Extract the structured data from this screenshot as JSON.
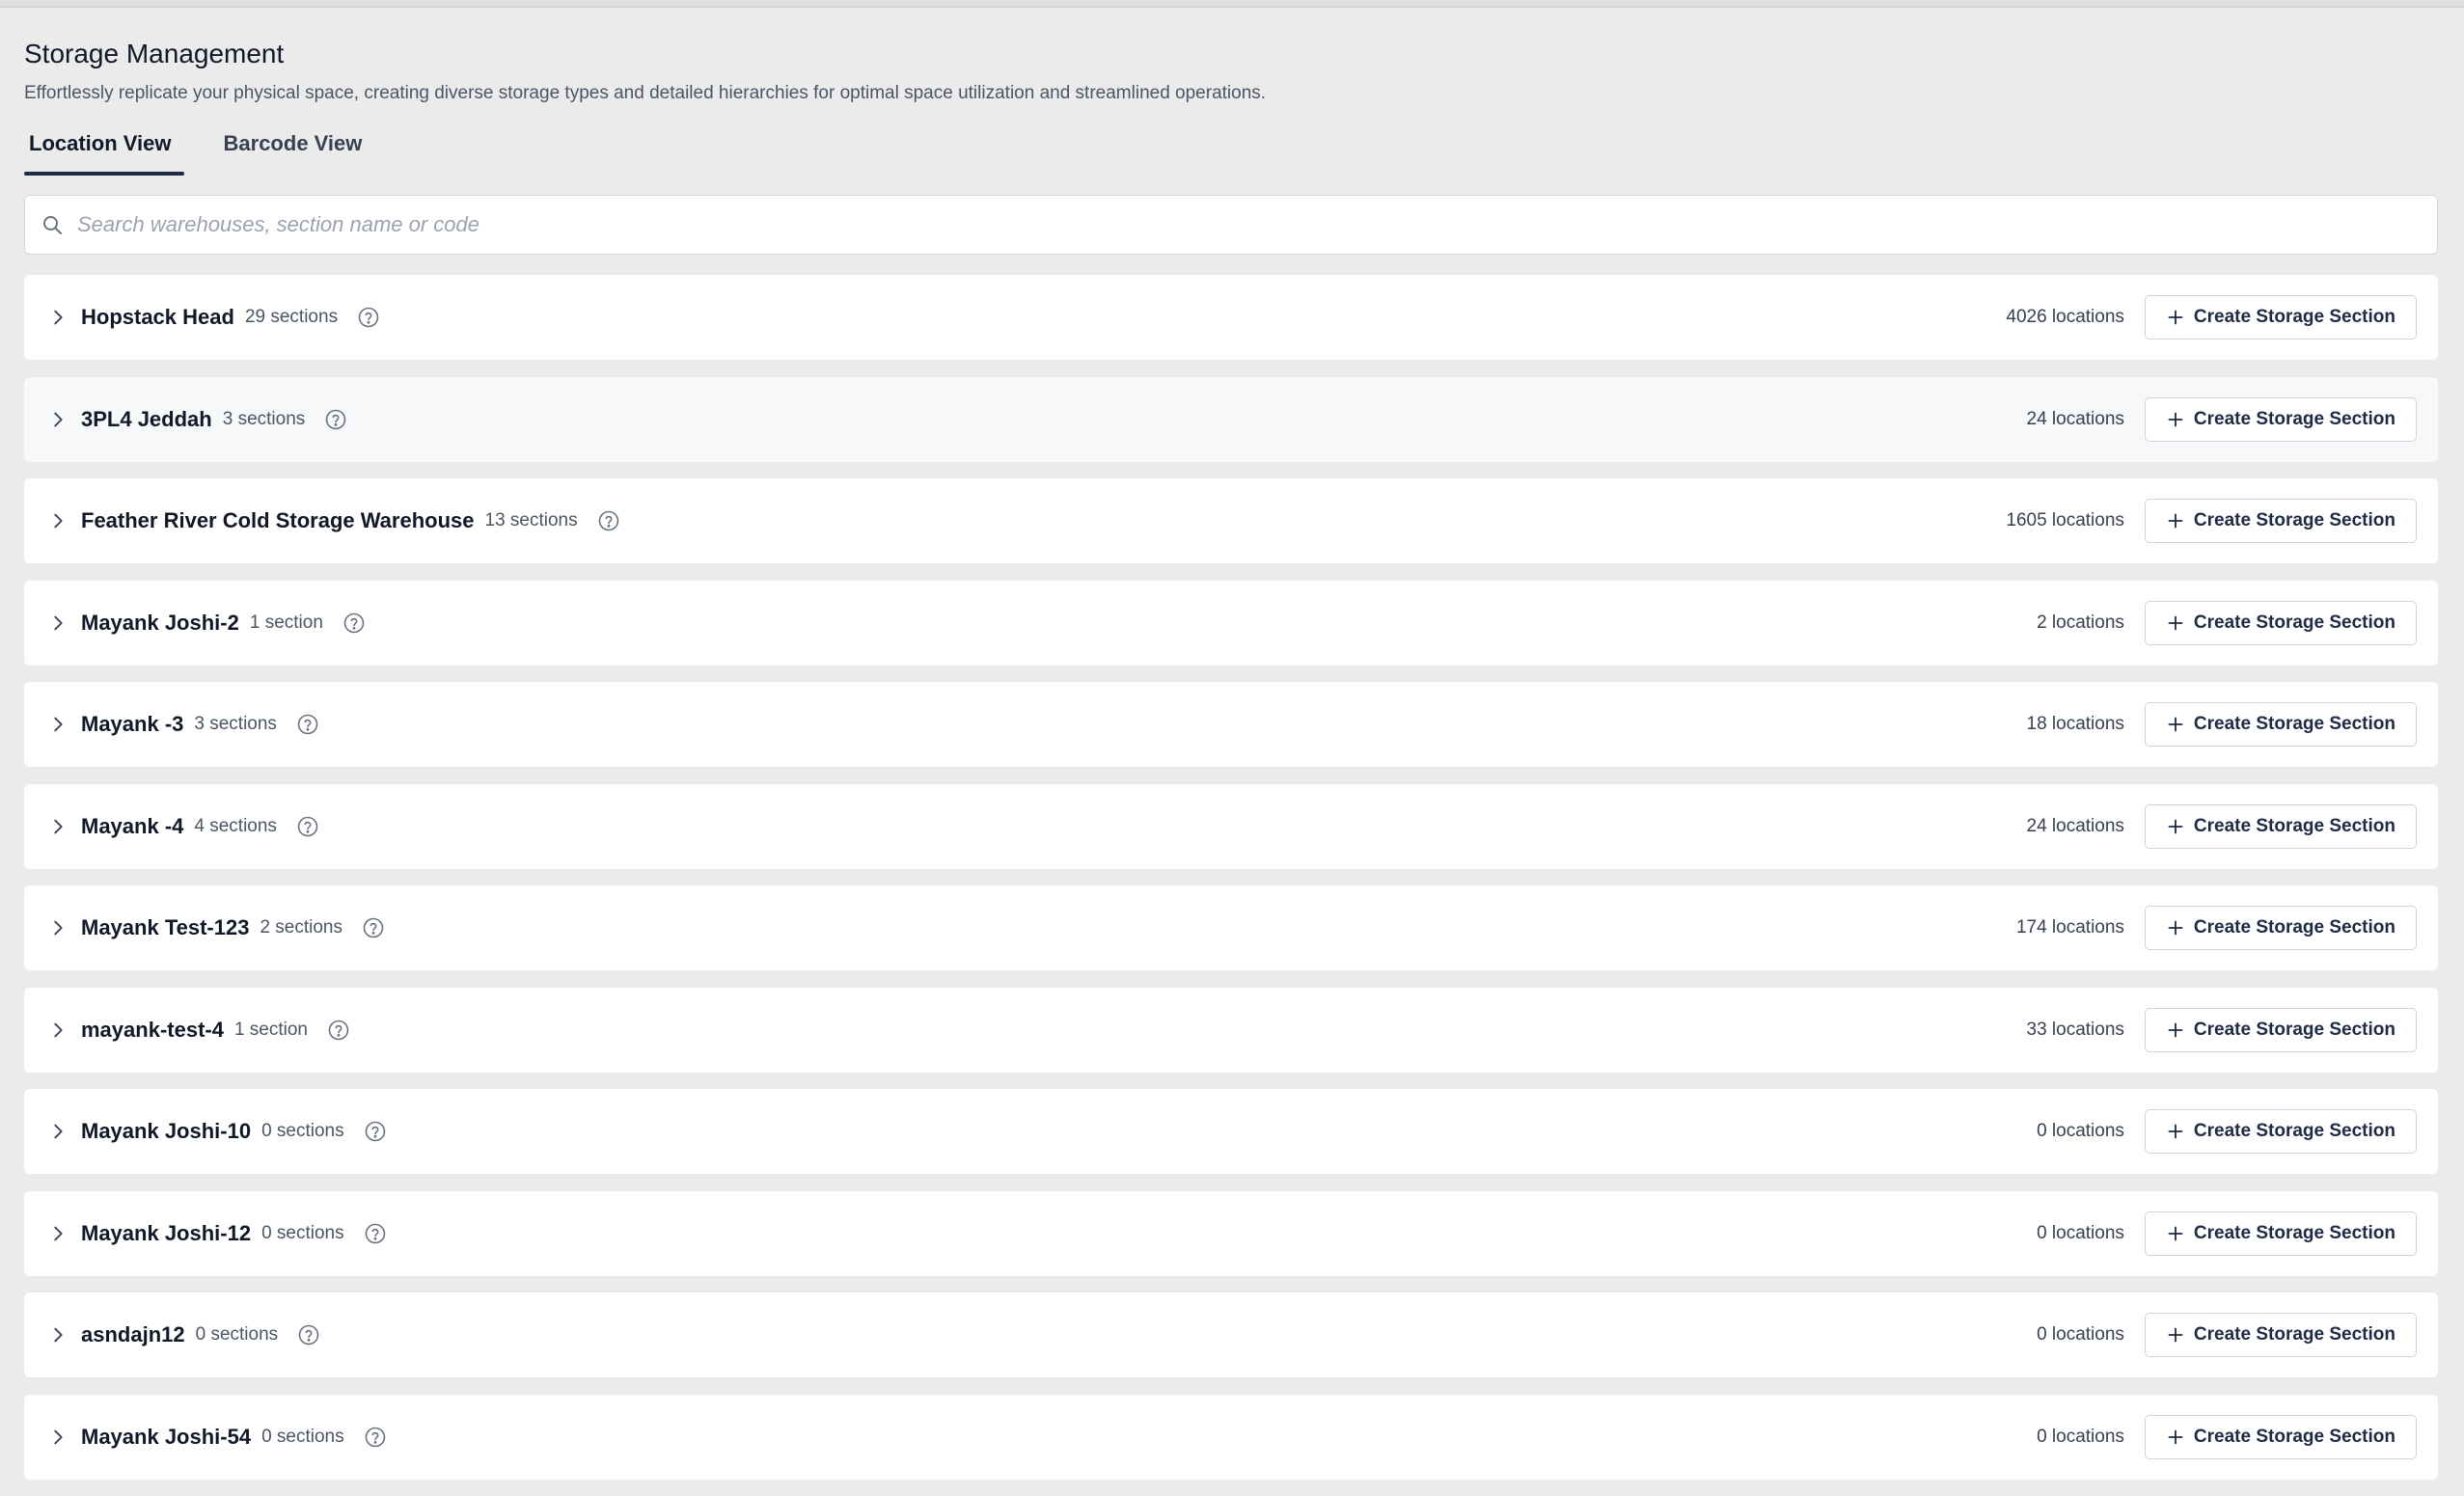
{
  "page": {
    "title": "Storage Management",
    "description": "Effortlessly replicate your physical space, creating diverse storage types and detailed hierarchies for optimal space utilization and streamlined operations."
  },
  "tabs": [
    {
      "label": "Location View",
      "active": true
    },
    {
      "label": "Barcode View",
      "active": false
    }
  ],
  "search": {
    "placeholder": "Search warehouses, section name or code",
    "value": ""
  },
  "create_button_label": "Create Storage Section",
  "warehouses": [
    {
      "name": "Hopstack Head",
      "sections": "29 sections",
      "locations": "4026 locations"
    },
    {
      "name": "3PL4 Jeddah",
      "sections": "3 sections",
      "locations": "24 locations"
    },
    {
      "name": "Feather River Cold Storage Warehouse",
      "sections": "13 sections",
      "locations": "1605 locations"
    },
    {
      "name": "Mayank Joshi-2",
      "sections": "1 section",
      "locations": "2 locations"
    },
    {
      "name": "Mayank -3",
      "sections": "3 sections",
      "locations": "18 locations"
    },
    {
      "name": "Mayank -4",
      "sections": "4 sections",
      "locations": "24 locations"
    },
    {
      "name": "Mayank Test-123",
      "sections": "2 sections",
      "locations": "174 locations"
    },
    {
      "name": "mayank-test-4",
      "sections": "1 section",
      "locations": "33 locations"
    },
    {
      "name": "Mayank Joshi-10",
      "sections": "0 sections",
      "locations": "0 locations"
    },
    {
      "name": "Mayank Joshi-12",
      "sections": "0 sections",
      "locations": "0 locations"
    },
    {
      "name": "asndajn12",
      "sections": "0 sections",
      "locations": "0 locations"
    },
    {
      "name": "Mayank Joshi-54",
      "sections": "0 sections",
      "locations": "0 locations"
    }
  ],
  "icons": {
    "search": "search-icon",
    "expand": "chevron-right-icon",
    "help": "help-circle-icon",
    "add": "plus-icon"
  },
  "colors": {
    "background": "#ebebeb",
    "card": "#ffffff",
    "accent": "#1f2a44",
    "muted_text": "#4b5563"
  }
}
